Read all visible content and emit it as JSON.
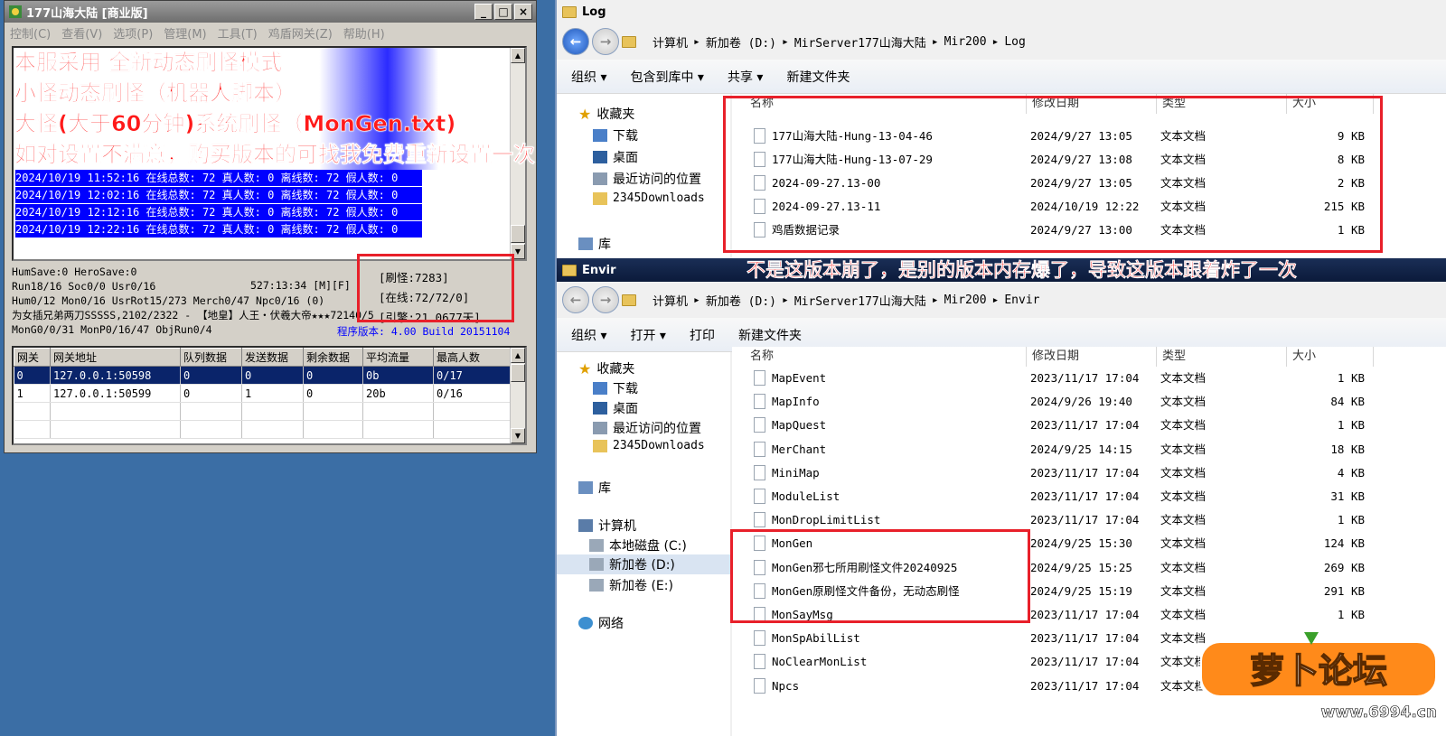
{
  "app": {
    "title": "177山海大陆 [商业版]",
    "menu": [
      "控制(C)",
      "查看(V)",
      "选项(P)",
      "管理(M)",
      "工具(T)",
      "鸡盾网关(Z)",
      "帮助(H)"
    ],
    "overlay_lines": [
      "本服采用 全新动态刷怪模式",
      "小怪动态刷怪（机器人脚本）",
      "大怪(大于60分钟)系统刷怪（MonGen.txt)",
      "如对设置不满意，购买版本的可找我免费重新设置一次"
    ],
    "log_lines": [
      "2024/10/19 11:52:16 在线总数: 72 真人数: 0 离线数: 72 假人数: 0",
      "2024/10/19 12:02:16 在线总数: 72 真人数: 0 离线数: 72 假人数: 0",
      "2024/10/19 12:12:16 在线总数: 72 真人数: 0 离线数: 72 假人数: 0",
      "2024/10/19 12:22:16 在线总数: 72 真人数: 0 离线数: 72 假人数: 0"
    ],
    "stats": [
      "HumSave:0 HeroSave:0",
      "Run18/16 Soc0/0 Usr0/16",
      "Hum0/12 Mon0/16 UsrRot15/273 Merch0/47 Npc0/16 (0)",
      "为女插兄弟两刀SSSSS,2102/2322 - 【地皇】人王・伏羲大帝★★★72140/5",
      "MonG0/0/31 MonP0/16/47 ObjRun0/4"
    ],
    "time_mode": "527:13:34 [M][F]",
    "counters": [
      "[刷怪:7283]",
      "[在线:72/72/0]",
      "[引擎:21.0677天]"
    ],
    "build": "程序版本: 4.00 Build 20151104",
    "gateway_table": {
      "headers": [
        "网关",
        "网关地址",
        "队列数据",
        "发送数据",
        "剩余数据",
        "平均流量",
        "最高人数"
      ],
      "rows": [
        [
          "0",
          "127.0.0.1:50598",
          "0",
          "0",
          "0",
          "0b",
          "0/17"
        ],
        [
          "1",
          "127.0.0.1:50599",
          "0",
          "1",
          "0",
          "20b",
          "0/16"
        ]
      ]
    }
  },
  "explorer1": {
    "title": "Log",
    "breadcrumbs": [
      "计算机",
      "新加卷 (D:)",
      "MirServer177山海大陆",
      "Mir200",
      "Log"
    ],
    "toolbar": [
      "组织 ▾",
      "包含到库中 ▾",
      "共享 ▾",
      "新建文件夹"
    ],
    "nav": [
      "收藏夹",
      "下载",
      "桌面",
      "最近访问的位置",
      "2345Downloads",
      "库"
    ],
    "columns": [
      "名称",
      "修改日期",
      "类型",
      "大小"
    ],
    "files": [
      {
        "name": "177山海大陆-Hung-13-04-46",
        "date": "2024/9/27 13:05",
        "type": "文本文档",
        "size": "9 KB"
      },
      {
        "name": "177山海大陆-Hung-13-07-29",
        "date": "2024/9/27 13:08",
        "type": "文本文档",
        "size": "8 KB"
      },
      {
        "name": "2024-09-27.13-00",
        "date": "2024/9/27 13:05",
        "type": "文本文档",
        "size": "2 KB"
      },
      {
        "name": "2024-09-27.13-11",
        "date": "2024/10/19 12:22",
        "type": "文本文档",
        "size": "215 KB"
      },
      {
        "name": "鸡盾数据记录",
        "date": "2024/9/27 13:00",
        "type": "文本文档",
        "size": "1 KB"
      }
    ]
  },
  "explorer2": {
    "title": "Envir",
    "breadcrumbs": [
      "计算机",
      "新加卷 (D:)",
      "MirServer177山海大陆",
      "Mir200",
      "Envir"
    ],
    "toolbar": [
      "组织 ▾",
      "打开 ▾",
      "打印",
      "新建文件夹"
    ],
    "nav": [
      "收藏夹",
      "下载",
      "桌面",
      "最近访问的位置",
      "2345Downloads",
      "库",
      "计算机",
      "本地磁盘 (C:)",
      "新加卷 (D:)",
      "新加卷 (E:)",
      "网络"
    ],
    "columns": [
      "名称",
      "修改日期",
      "类型",
      "大小"
    ],
    "files": [
      {
        "name": "MapEvent",
        "date": "2023/11/17 17:04",
        "type": "文本文档",
        "size": "1 KB"
      },
      {
        "name": "MapInfo",
        "date": "2024/9/26 19:40",
        "type": "文本文档",
        "size": "84 KB"
      },
      {
        "name": "MapQuest",
        "date": "2023/11/17 17:04",
        "type": "文本文档",
        "size": "1 KB"
      },
      {
        "name": "MerChant",
        "date": "2024/9/25 14:15",
        "type": "文本文档",
        "size": "18 KB"
      },
      {
        "name": "MiniMap",
        "date": "2023/11/17 17:04",
        "type": "文本文档",
        "size": "4 KB"
      },
      {
        "name": "ModuleList",
        "date": "2023/11/17 17:04",
        "type": "文本文档",
        "size": "31 KB"
      },
      {
        "name": "MonDropLimitList",
        "date": "2023/11/17 17:04",
        "type": "文本文档",
        "size": "1 KB"
      },
      {
        "name": "MonGen",
        "date": "2024/9/25 15:30",
        "type": "文本文档",
        "size": "124 KB"
      },
      {
        "name": "MonGen邪七所用刷怪文件20240925",
        "date": "2024/9/25 15:25",
        "type": "文本文档",
        "size": "269 KB"
      },
      {
        "name": "MonGen原刷怪文件备份，无动态刷怪",
        "date": "2024/9/25 15:19",
        "type": "文本文档",
        "size": "291 KB"
      },
      {
        "name": "MonSayMsg",
        "date": "2023/11/17 17:04",
        "type": "文本文档",
        "size": "1 KB"
      },
      {
        "name": "MonSpAbilList",
        "date": "2023/11/17 17:04",
        "type": "文本文档",
        "size": ""
      },
      {
        "name": "NoClearMonList",
        "date": "2023/11/17 17:04",
        "type": "文本文档",
        "size": ""
      },
      {
        "name": "Npcs",
        "date": "2023/11/17 17:04",
        "type": "文本文档",
        "size": ""
      }
    ]
  },
  "annotation": "不是这版本崩了，是别的版本内存爆了，导致这版本跟着炸了一次",
  "watermark": {
    "brand": "萝卜论坛",
    "url": "www.6994.cn"
  },
  "colors": {
    "annotation_red": "#e8202a",
    "log_blue": "#0000ff",
    "selection": "#0a246a"
  }
}
